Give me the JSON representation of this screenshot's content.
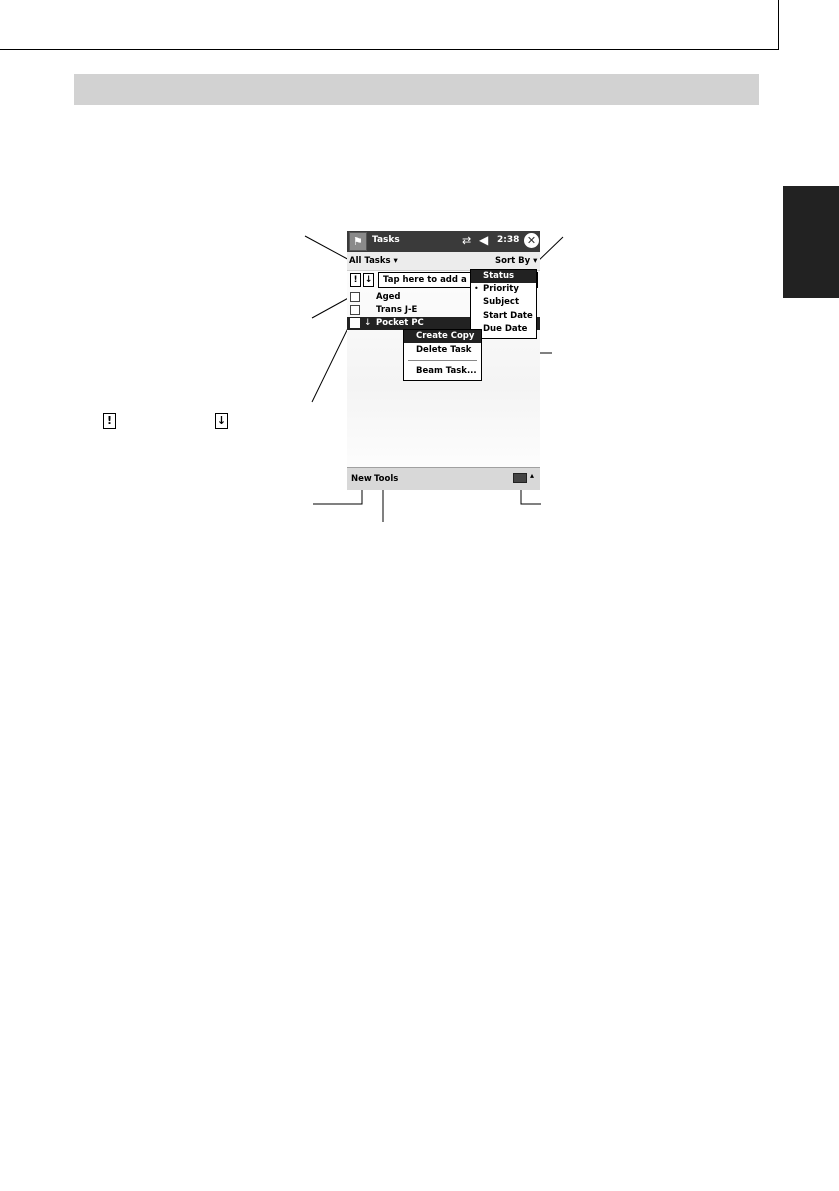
{
  "device": {
    "title": "Tasks",
    "time": "2:38",
    "start_icon": "windows-flag-icon",
    "connection_icon": "connectivity-icon",
    "volume_icon": "speaker-icon",
    "close_icon": "close-icon",
    "close_glyph": "✕"
  },
  "filter": {
    "label": "All Tasks ▾"
  },
  "sort": {
    "label": "Sort By ▾"
  },
  "entry": {
    "priority_glyph": "!",
    "low_priority_glyph": "↓",
    "placeholder": "Tap here to add a new task"
  },
  "tasks": [
    {
      "label": "Aged"
    },
    {
      "label": "Trans J-E"
    },
    {
      "label": "Pocket PC",
      "glyph": "↓"
    }
  ],
  "sort_menu": {
    "items": [
      {
        "label": "Status"
      },
      {
        "label": "Priority",
        "bullet": "•"
      },
      {
        "label": "Subject"
      },
      {
        "label": "Start Date"
      },
      {
        "label": "Due Date"
      }
    ]
  },
  "context_menu": {
    "items": [
      {
        "label": "Create Copy"
      },
      {
        "label": "Delete Task"
      },
      {
        "label": "Beam Task..."
      }
    ]
  },
  "command_bar": {
    "new_label": "New",
    "tools_label": "Tools",
    "keyboard_icon": "keyboard-icon",
    "arrow_glyph": "▴"
  },
  "legend": {
    "high_glyph": "!",
    "low_glyph": "↓"
  }
}
